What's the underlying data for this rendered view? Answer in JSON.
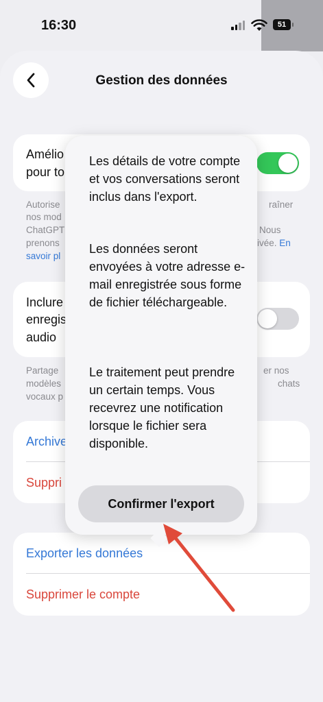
{
  "status_bar": {
    "time": "16:30",
    "battery": "51"
  },
  "header": {
    "title": "Gestion des données",
    "back_icon": "chevron-left-icon"
  },
  "settings": {
    "improve": {
      "label_line1": "Amélio",
      "label_line2": "pour to",
      "enabled": true
    },
    "improve_desc": {
      "line1_left": "Autorise",
      "line1_right": "raîner",
      "line2_left": "nos mod",
      "line3_left": "ChatGPT",
      "line3_right": "Nous",
      "line4_left": "prenons",
      "line4_right": "ivée.",
      "line4_link": "En",
      "line5_link": "savoir pl"
    },
    "audio": {
      "label_line1": "Inclure",
      "label_line2": "enregis",
      "label_line3": "audio",
      "enabled": false
    },
    "audio_desc": {
      "line1_left": "Partage",
      "line1_right": "er nos",
      "line2_left": "modèles",
      "line2_right": "chats",
      "line3_left": "vocaux p"
    },
    "archive_label": "Archive",
    "delete_label": "Suppri",
    "export_label": "Exporter les données",
    "delete_account_label": "Supprimer le compte"
  },
  "popover": {
    "para1": "Les détails de votre compte et vos conversations seront inclus dans l'export.",
    "para2": "Les données seront envoyées à votre adresse e-mail enregistrée sous forme de fichier téléchargeable.",
    "para3": "Le traitement peut prendre un certain temps. Vous recevrez une notification lorsque le fichier sera disponible.",
    "confirm_label": "Confirmer l'export"
  },
  "colors": {
    "accent": "#3478d6",
    "destructive": "#d9463b",
    "toggle_on": "#34c759",
    "annotation_arrow": "#e04b3a"
  }
}
